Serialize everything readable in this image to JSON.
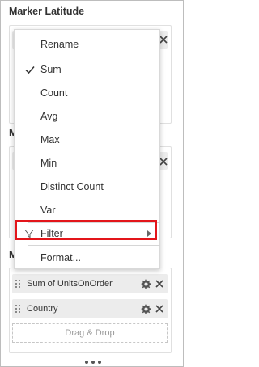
{
  "panel": {
    "section1_title": "Marker Latitude",
    "section2_clip": "M",
    "section3_clip": "M",
    "fields": [
      {
        "label": "Sum of UnitsOnOrder"
      },
      {
        "label": "Country"
      }
    ],
    "dropzone_label": "Drag & Drop"
  },
  "menu": {
    "items": [
      {
        "label": "Rename"
      },
      {
        "label": "Sum",
        "checked": true
      },
      {
        "label": "Count"
      },
      {
        "label": "Avg"
      },
      {
        "label": "Max"
      },
      {
        "label": "Min"
      },
      {
        "label": "Distinct Count"
      },
      {
        "label": "Var"
      },
      {
        "label": "Filter",
        "icon": "filter-icon",
        "submenu": true,
        "highlighted": true
      },
      {
        "label": "Format..."
      }
    ]
  },
  "colors": {
    "highlight_border": "#e3151a",
    "pill_bg": "#ececec"
  }
}
